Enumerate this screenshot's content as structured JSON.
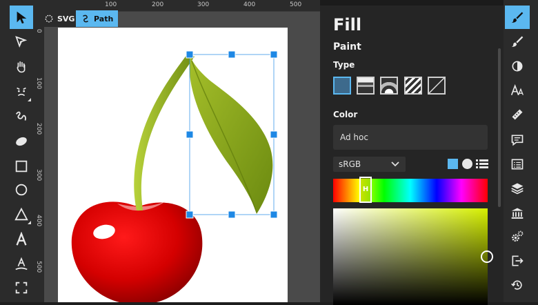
{
  "context_bar": {
    "svg_label": "SVG",
    "path_label": "Path"
  },
  "rulers": {
    "top": [
      "100",
      "200",
      "300",
      "400",
      "500"
    ],
    "left": [
      "0",
      "100",
      "200",
      "300",
      "400",
      "500"
    ]
  },
  "panel": {
    "title": "Fill",
    "paint_heading": "Paint",
    "type_label": "Type",
    "color_label": "Color",
    "color_value": "Ad hoc",
    "color_space": "sRGB",
    "hue_handle_label": "H",
    "paint_types": [
      "flat",
      "linear-gradient",
      "radial-gradient",
      "pattern",
      "none"
    ],
    "selected_paint_type": "flat"
  },
  "left_tools": [
    "pointer-tool",
    "node-tool",
    "hand-tool",
    "face-tool",
    "freehand-tool",
    "ellipse-tool",
    "rectangle-tool",
    "circle-tool",
    "triangle-tool",
    "text-tool",
    "text-path-tool",
    "fullscreen-tool"
  ],
  "right_tools": [
    "fill-tool",
    "stroke-tool",
    "opacity-tool",
    "typography-tool",
    "ruler-tool",
    "comment-tool",
    "list-tool",
    "layers-tool",
    "library-tool",
    "settings-tool",
    "export-tool",
    "history-tool"
  ],
  "colors": {
    "accent": "#5bb8f0",
    "cherry": "#d40000",
    "leaf": "#8aa61a",
    "selection": "#1e88e5"
  }
}
